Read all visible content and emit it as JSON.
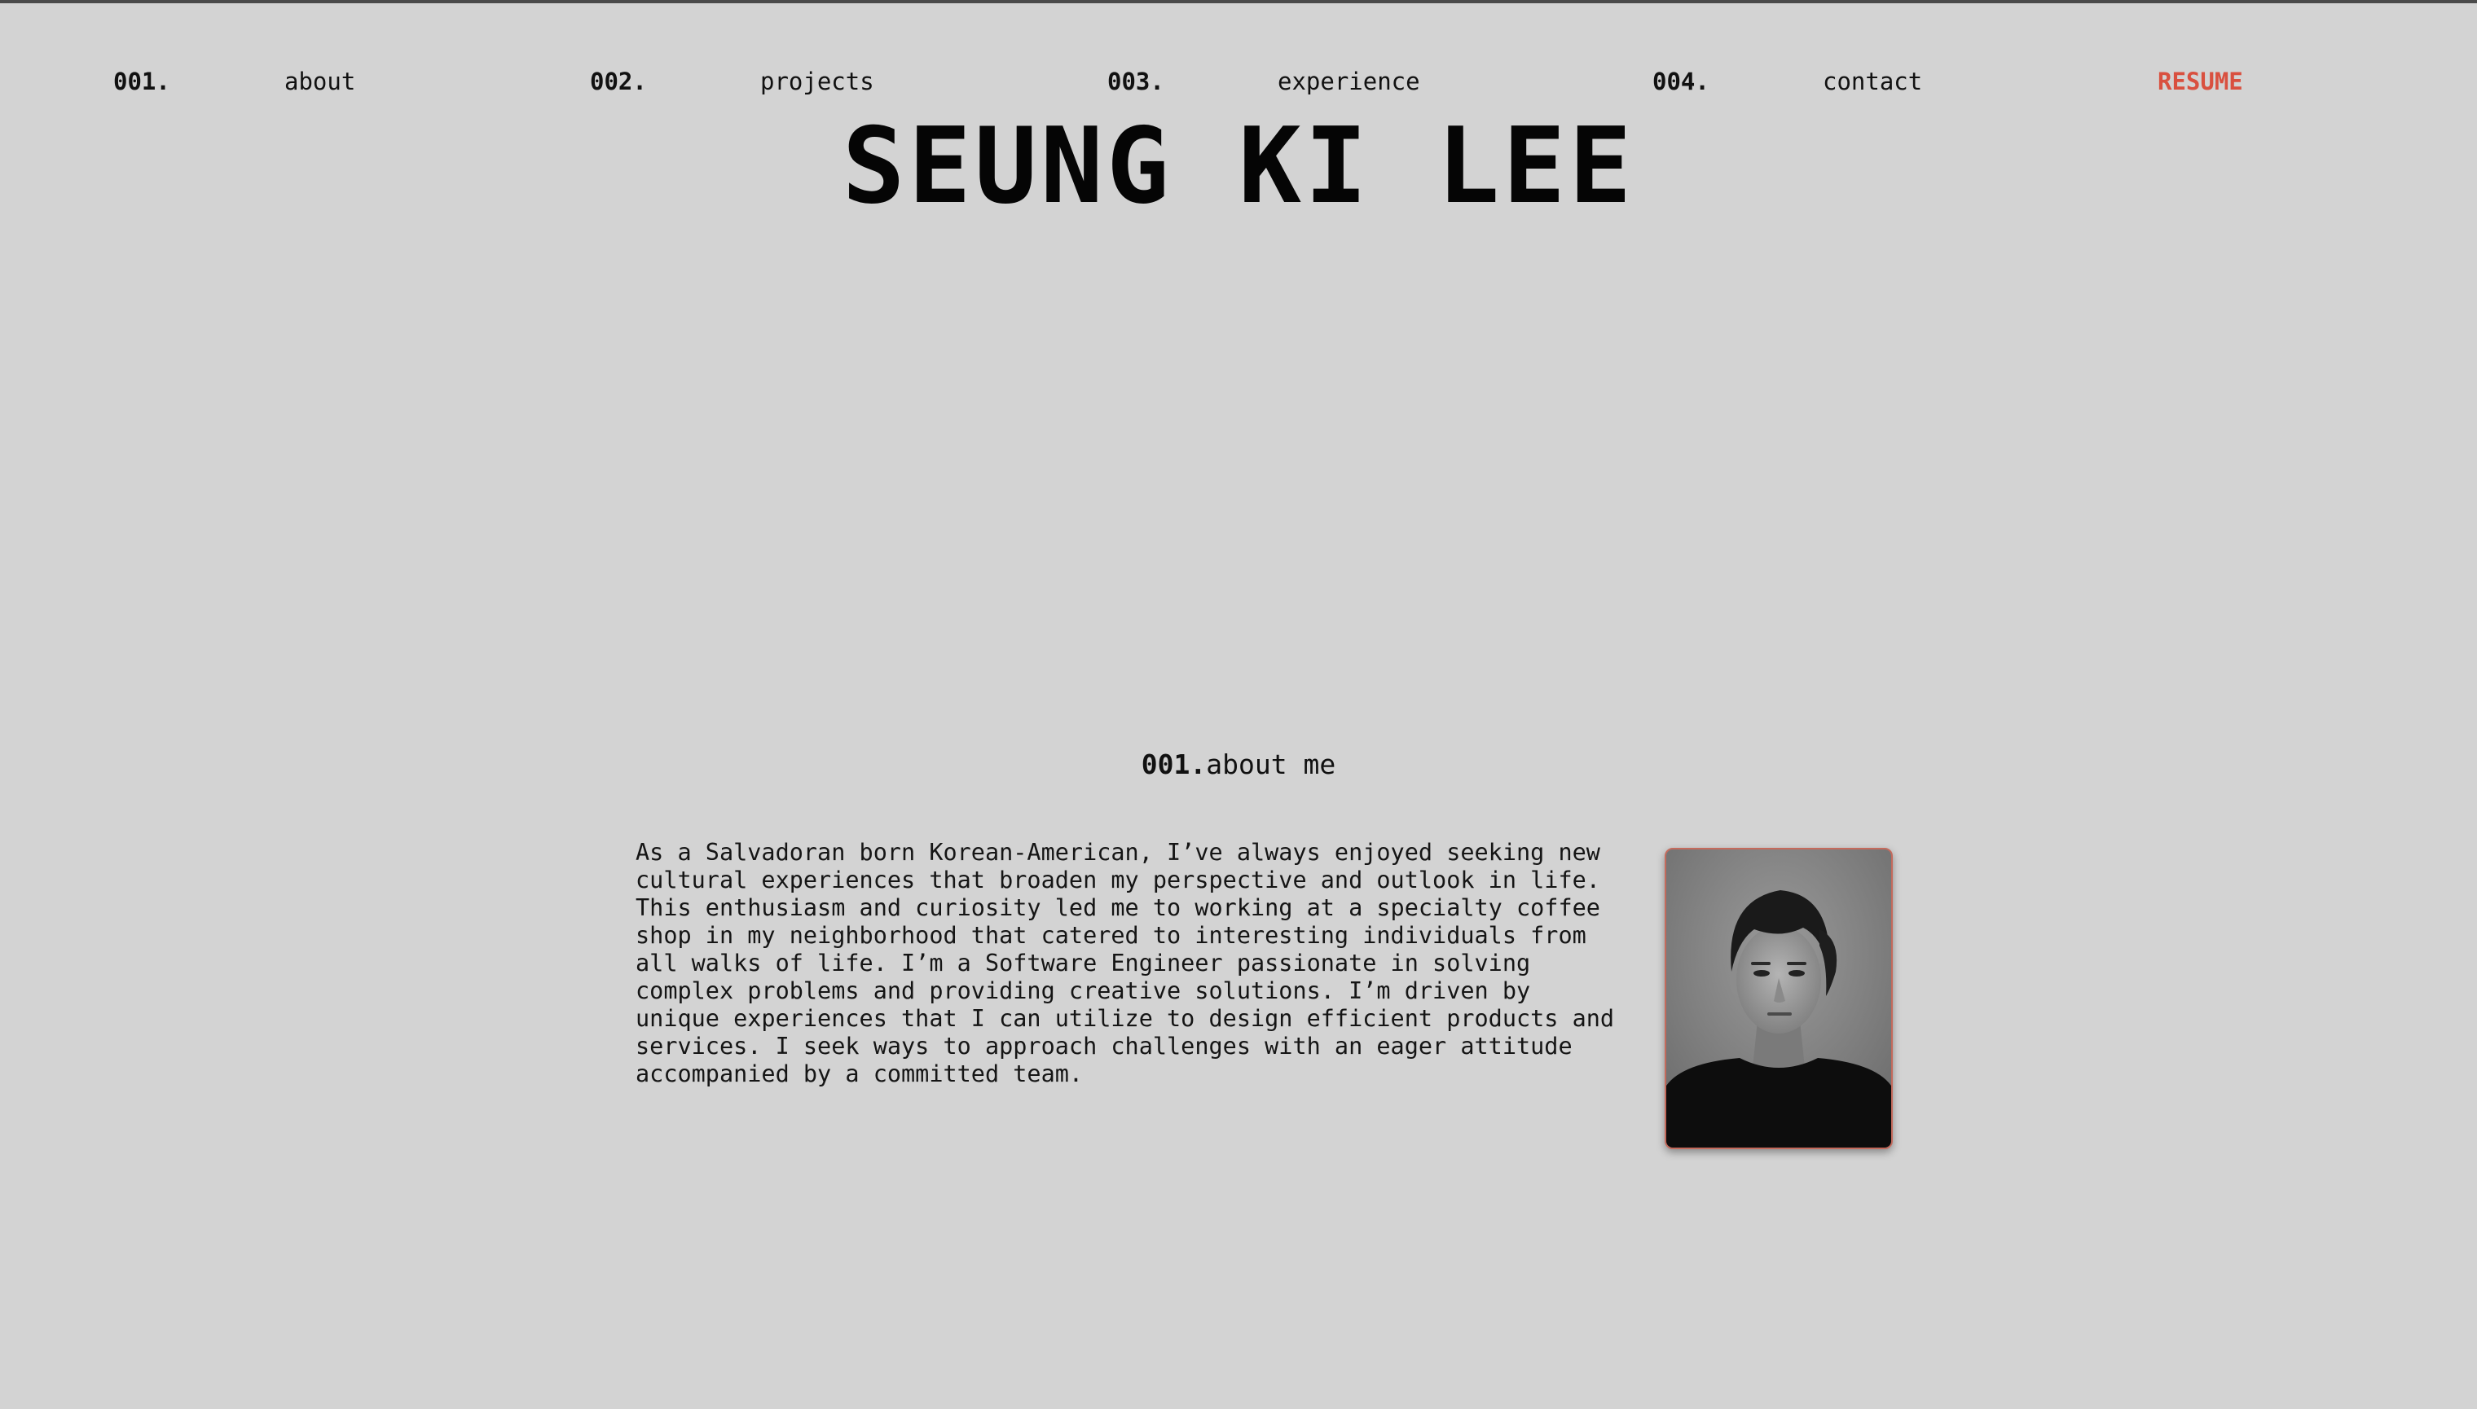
{
  "nav": {
    "items": [
      {
        "num": "001.",
        "label": "about"
      },
      {
        "num": "002.",
        "label": "projects"
      },
      {
        "num": "003.",
        "label": "experience"
      },
      {
        "num": "004.",
        "label": "contact"
      }
    ],
    "resume_label": "RESUME"
  },
  "hero": {
    "name": "SEUNG KI LEE"
  },
  "about": {
    "heading_num": "001.",
    "heading_label": "about me",
    "body": "As a Salvadoran born Korean-American, I’ve always enjoyed seeking new cultural experiences that broaden my perspective and outlook in life. This enthusiasm and curiosity led me to working at a specialty coffee shop in my neighborhood that catered to interesting individuals from all walks of life. I’m a Software Engineer passionate in solving complex problems and providing creative solutions. I’m driven by unique experiences that I can utilize to design efficient products and services. I seek ways to approach challenges with an eager attitude accompanied by a committed team."
  },
  "colors": {
    "background": "#d3d3d3",
    "accent": "#d9503f",
    "text": "#111111",
    "photo_border": "#c46a5c"
  }
}
